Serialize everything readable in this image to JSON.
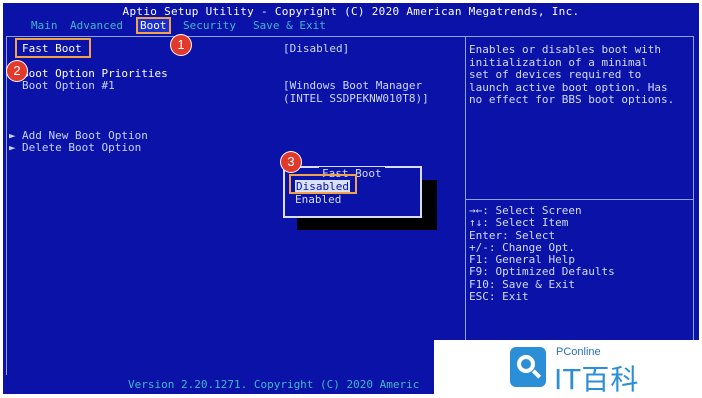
{
  "header": {
    "title": "Aptio Setup Utility - Copyright (C) 2020 American Megatrends, Inc."
  },
  "tabs": [
    {
      "label": "Main"
    },
    {
      "label": "Advanced"
    },
    {
      "label": "Boot"
    },
    {
      "label": "Security"
    },
    {
      "label": "Save & Exit"
    }
  ],
  "settings": {
    "fast_boot": {
      "label": "Fast Boot",
      "value": "[Disabled]"
    },
    "boot_option_priorities": {
      "label": "Boot Option Priorities"
    },
    "boot_option_1": {
      "label": "Boot Option #1",
      "value_line1": "[Windows Boot Manager",
      "value_line2": "(INTEL SSDPEKNW010T8)]"
    },
    "add_new_boot_option": {
      "label": "Add New Boot Option"
    },
    "delete_boot_option": {
      "label": "Delete Boot Option"
    }
  },
  "help": {
    "text": "Enables or disables boot with\ninitialization of a minimal\nset of devices required to\nlaunch active boot option. Has\nno effect for BBS boot options."
  },
  "keys": {
    "text": "→←: Select Screen\n↑↓: Select Item\nEnter: Select\n+/-: Change Opt.\nF1: General Help\nF9: Optimized Defaults\nF10: Save & Exit\nESC: Exit"
  },
  "popup": {
    "title": "Fast Boot",
    "options": [
      "Disabled",
      "Enabled"
    ]
  },
  "footer": {
    "text": "Version 2.20.1271. Copyright (C) 2020 Americ"
  },
  "annotations": [
    "1",
    "2",
    "3"
  ],
  "watermark": {
    "small": "PConline",
    "big": "IT百科"
  },
  "colors": {
    "bios_blue": "#0a12a8",
    "highlight_orange": "#f1a24b",
    "badge_red": "#e13a2a",
    "tab_cyan": "#3fb8c8"
  }
}
